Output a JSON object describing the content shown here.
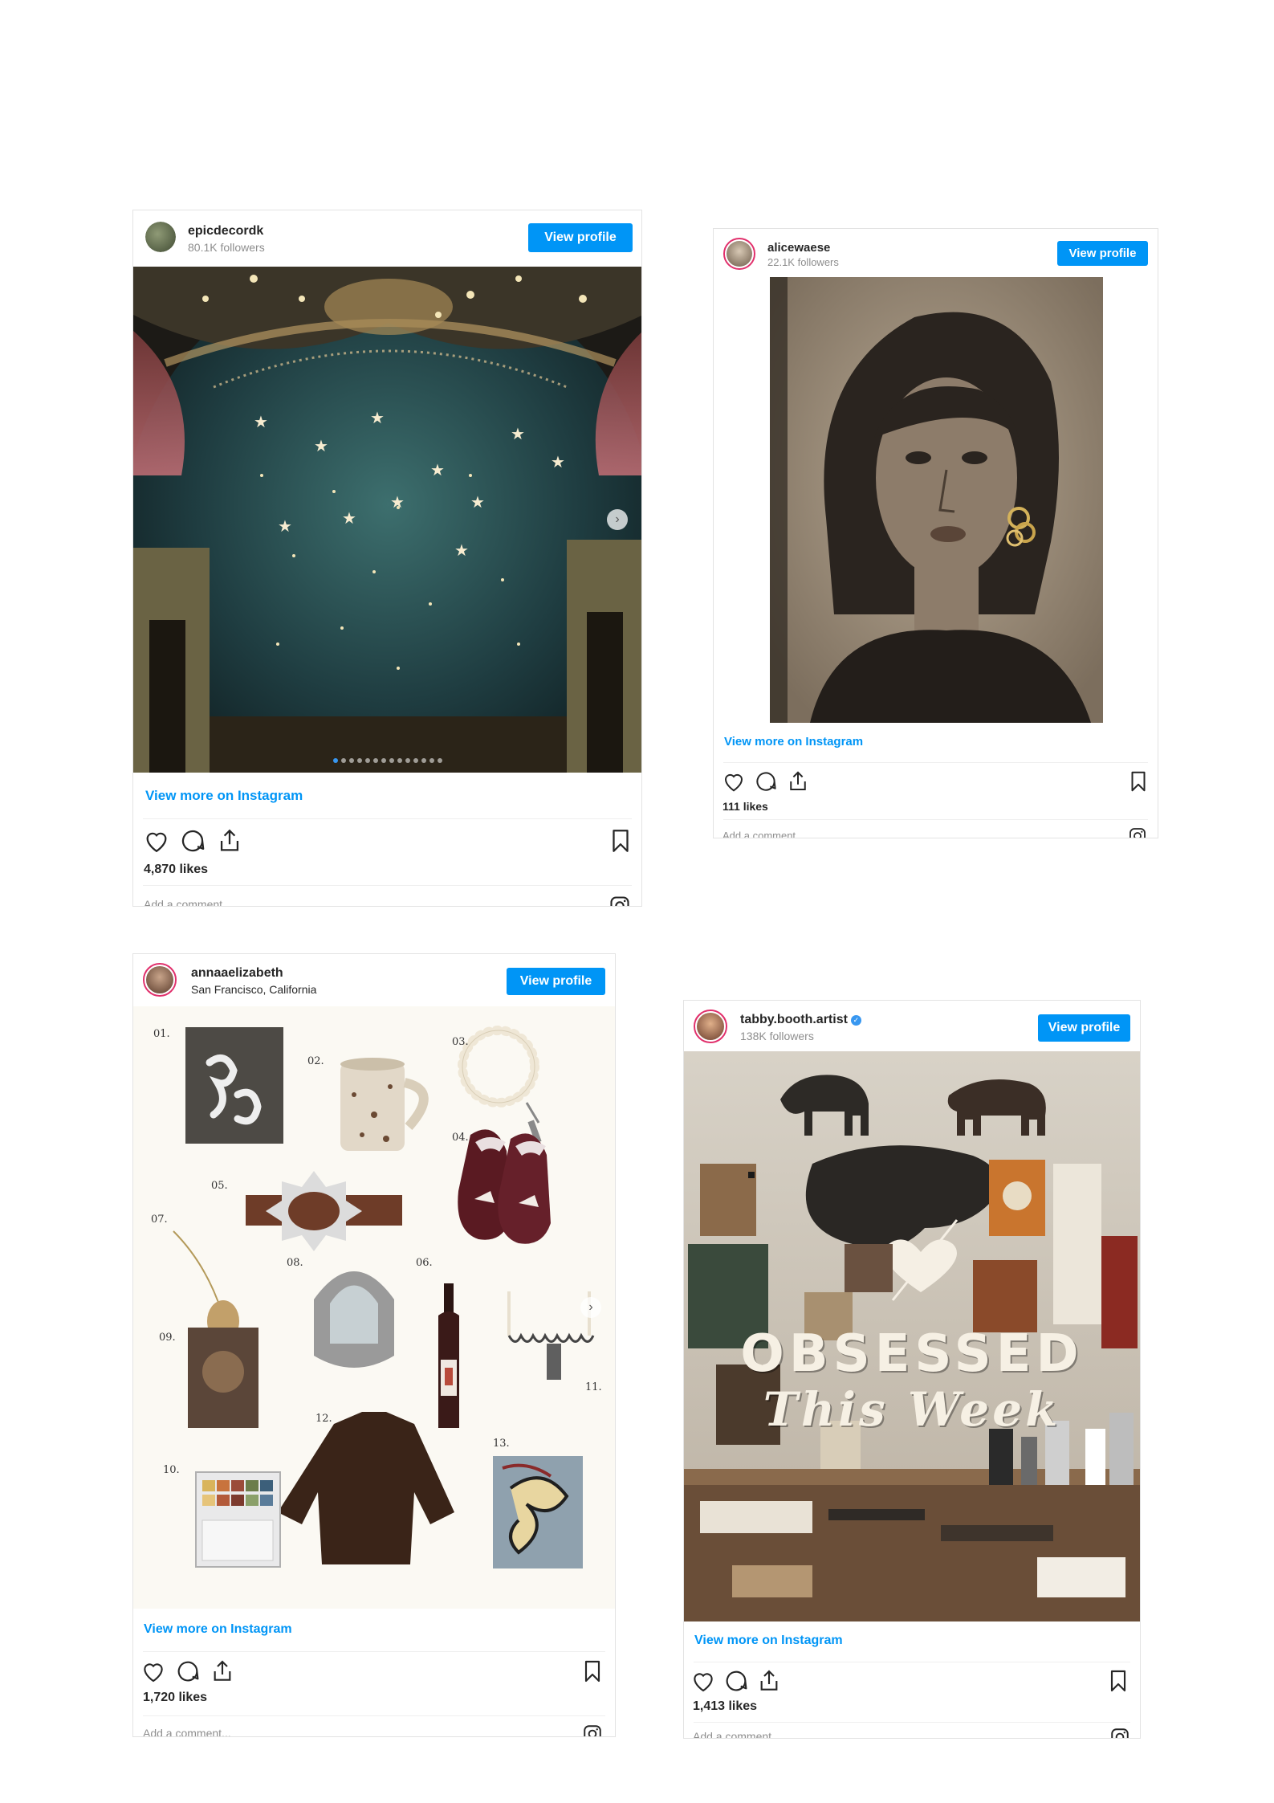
{
  "posts": [
    {
      "username": "epicdecordk",
      "meta": "80.1K followers",
      "view_profile": "View profile",
      "view_more": "View more on Instagram",
      "likes": "4,870 likes",
      "add_comment": "Add a comment..."
    },
    {
      "username": "alicewaese",
      "meta": "22.1K followers",
      "view_profile": "View profile",
      "view_more": "View more on Instagram",
      "likes": "111 likes",
      "add_comment": "Add a comment..."
    },
    {
      "username": "annaaelizabeth",
      "meta": "San Francisco, California",
      "view_profile": "View profile",
      "view_more": "View more on Instagram",
      "likes": "1,720 likes",
      "add_comment": "Add a comment...",
      "item_numbers": [
        "01.",
        "02.",
        "03.",
        "04.",
        "05.",
        "06.",
        "07.",
        "08.",
        "09.",
        "10.",
        "11.",
        "12.",
        "13."
      ]
    },
    {
      "username": "tabby.booth.artist",
      "meta": "138K followers",
      "view_profile": "View profile",
      "view_more": "View more on Instagram",
      "likes": "1,413 likes",
      "add_comment": "Add a comment...",
      "overlay_line1": "OBSESSED",
      "overlay_line2": "This Week"
    }
  ],
  "colors": {
    "accent": "#0095f6",
    "text": "#262626",
    "muted": "#8e8e8e",
    "border": "#e3e3e3"
  },
  "icons": [
    "heart-icon",
    "comment-icon",
    "share-icon",
    "bookmark-icon",
    "instagram-logo-icon",
    "chevron-right-icon",
    "verified-badge-icon"
  ]
}
